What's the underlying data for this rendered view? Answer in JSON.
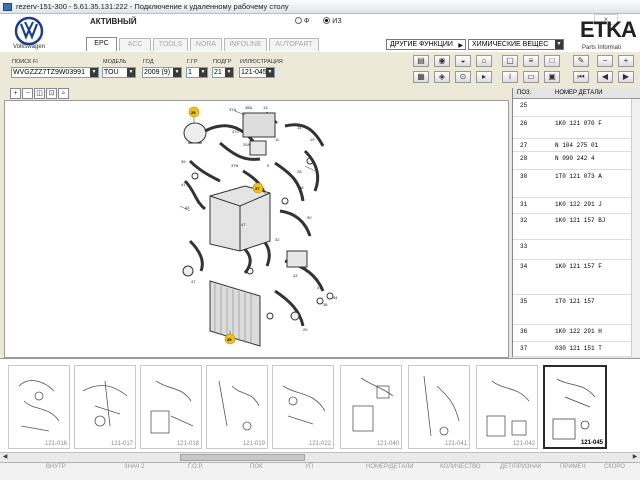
{
  "window": {
    "title": "rezerv-151-300 - 5.61.35.131:222 - Подключение к удаленному рабочему столу"
  },
  "header": {
    "brand_name": "Volkswagen",
    "status": "АКТИВНЫЙ",
    "radio_options": [
      {
        "label": "Ф",
        "selected": false
      },
      {
        "label": "ИЗ",
        "selected": true
      }
    ],
    "app_name": "ETKA",
    "app_subtitle": "Parts Informati"
  },
  "tabs": [
    {
      "label": "EPC",
      "active": true
    },
    {
      "label": "ACC",
      "active": false
    },
    {
      "label": "TOOLS",
      "active": false
    },
    {
      "label": "NORA",
      "active": false
    },
    {
      "label": "INFOLINE",
      "active": false
    },
    {
      "label": "AUTOPART",
      "active": false
    }
  ],
  "functions": {
    "other_label": "ДРУГИЕ ФУНКЦИИ",
    "chemicals_label": "ХИМИЧЕСКИЕ ВЕЩЕС"
  },
  "fields": {
    "search_label": "ПОИСК FI",
    "search_value": "WVGZZZ7TZ9W03991",
    "model_label": "МОДЕЛЬ",
    "model_value": "TOU",
    "year_label": "ГОД",
    "year_value": "2009 (9)",
    "group_label": "Г.ГР",
    "group_value": "1",
    "subgroup_label": "ПОДГР",
    "subgroup_value": "21",
    "illustration_label": "ИЛЛЮСТРАЦИЯ",
    "illustration_value": "121-045"
  },
  "parts_list": {
    "col_pos": "ПОЗ.",
    "col_number": "НОМЕР ДЕТАЛИ",
    "rows": [
      {
        "pos": "25",
        "number": ""
      },
      {
        "pos": "26",
        "number": "1K0 121 070 F"
      },
      {
        "pos": "27",
        "number": "N  104 275 01"
      },
      {
        "pos": "28",
        "number": "N  090 242 4"
      },
      {
        "pos": "30",
        "number": "1T0 121 073 A"
      },
      {
        "pos": "31",
        "number": "1K0 122 291 J"
      },
      {
        "pos": "32",
        "number": "1K0 121 157 BJ"
      },
      {
        "pos": "33",
        "number": ""
      },
      {
        "pos": "34",
        "number": "1K0 121 157 F"
      },
      {
        "pos": "35",
        "number": "1T0 121 157"
      },
      {
        "pos": "36",
        "number": "1K0 122 291 H"
      },
      {
        "pos": "37",
        "number": "030 121 151 T"
      }
    ]
  },
  "thumbnails": [
    {
      "label": "121-016",
      "selected": false
    },
    {
      "label": "121-017",
      "selected": false
    },
    {
      "label": "121-018",
      "selected": false
    },
    {
      "label": "121-019",
      "selected": false
    },
    {
      "label": "121-022",
      "selected": false
    },
    {
      "label": "121-040",
      "selected": false
    },
    {
      "label": "121-041",
      "selected": false
    },
    {
      "label": "121-042",
      "selected": false
    },
    {
      "label": "121-045",
      "selected": true
    }
  ],
  "callouts": {
    "top": "25",
    "middle": "27",
    "bottom": "35"
  },
  "bottom_status": [
    "ВНУТР",
    "ЗНАЧ 2",
    "Г.О.Р.",
    "ПОК",
    "УП",
    "НОМЕР/ДЕТАЛИ",
    "КОЛИЧЕСТВО",
    "ДЕТ/ПРИЗНАК",
    "ПРИМЕЧ",
    "СКОРО"
  ]
}
